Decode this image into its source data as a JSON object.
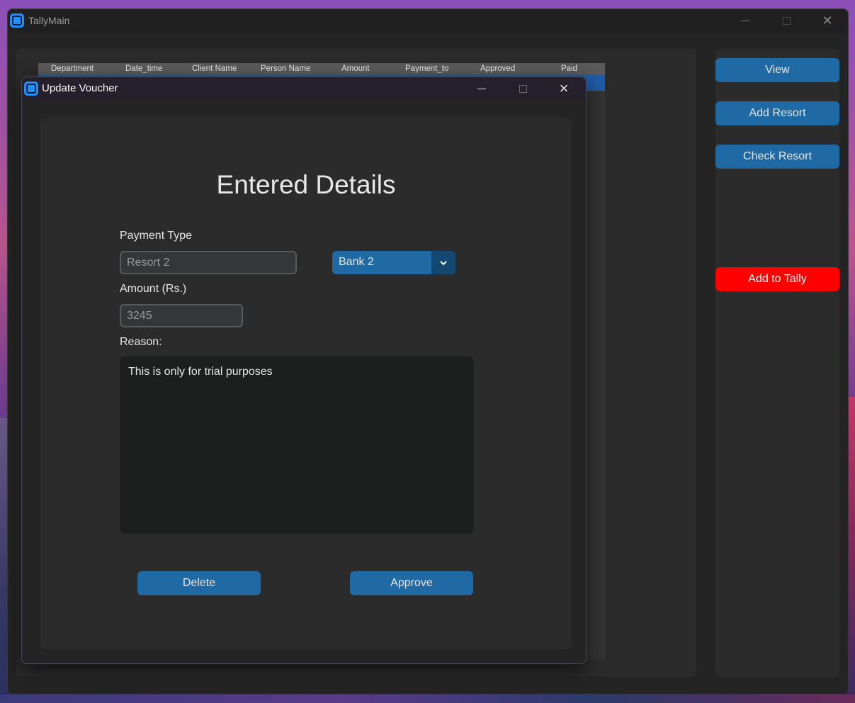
{
  "main_window": {
    "title": "TallyMain",
    "table": {
      "columns": [
        "Department",
        "Date_time",
        "Client Name",
        "Person Name",
        "Amount",
        "Payment_to",
        "Approved",
        "Paid"
      ]
    },
    "sidebar": {
      "view_label": "View",
      "add_resort_label": "Add Resort",
      "check_resort_label": "Check Resort",
      "add_to_tally_label": "Add to Tally"
    }
  },
  "dialog": {
    "title": "Update Voucher",
    "heading": "Entered Details",
    "payment_type_label": "Payment Type",
    "payment_type_value": "Resort 2",
    "bank_value": "Bank 2",
    "amount_label": "Amount (Rs.)",
    "amount_value": "3245",
    "reason_label": "Reason:",
    "reason_value": "This is only for trial purposes",
    "delete_label": "Delete",
    "approve_label": "Approve"
  },
  "colors": {
    "accent_button": "#1f6aa5",
    "danger_button": "#ff0000",
    "window_bg": "#242424",
    "frame_bg": "#2b2b2b"
  }
}
